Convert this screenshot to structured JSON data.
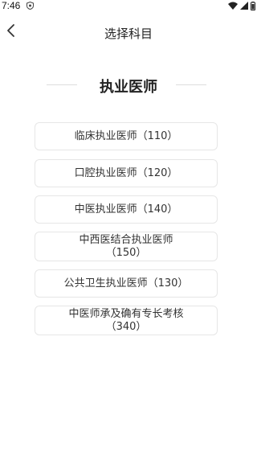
{
  "status_bar": {
    "time": "7:46",
    "icons": [
      "shield-icon",
      "wifi-icon",
      "signal-icon",
      "battery-icon"
    ]
  },
  "header": {
    "back_icon": "chevron-left-icon",
    "title": "选择科目"
  },
  "section": {
    "title": "执业医师"
  },
  "options": [
    {
      "line1": "临床执业医师（110）",
      "line2": ""
    },
    {
      "line1": "口腔执业医师（120）",
      "line2": ""
    },
    {
      "line1": "中医执业医师（140）",
      "line2": ""
    },
    {
      "line1": "中西医结合执业医师",
      "line2": "（150）"
    },
    {
      "line1": "公共卫生执业医师（130）",
      "line2": ""
    },
    {
      "line1": "中医师承及确有专长考核",
      "line2": "（340）"
    }
  ],
  "colors": {
    "background": "#ffffff",
    "card_border": "#e6e6e6",
    "text": "#333333",
    "divider": "#dddddd"
  }
}
